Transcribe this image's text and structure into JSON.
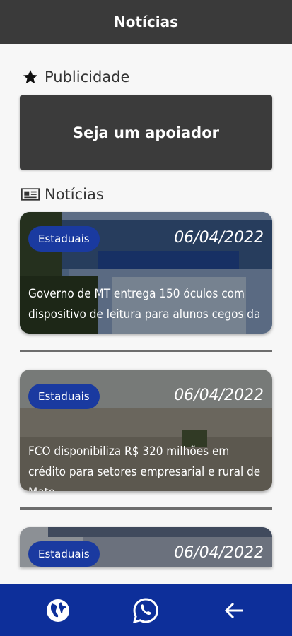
{
  "appbar": {
    "title": "Notícias"
  },
  "ad_section": {
    "title": "Publicidade",
    "banner_text": "Seja um apoiador"
  },
  "news_section": {
    "title": "Notícias"
  },
  "news": [
    {
      "badge": "Estaduais",
      "date": "06/04/2022",
      "headline": "Governo de MT entrega 150 óculos com dispositivo de leitura para alunos cegos da ..."
    },
    {
      "badge": "Estaduais",
      "date": "06/04/2022",
      "headline": "FCO disponibiliza R$ 320 milhões em crédito para setores empresarial e rural de Mato ..."
    },
    {
      "badge": "Estaduais",
      "date": "06/04/2022",
      "headline": ""
    }
  ],
  "nav": {
    "icons": [
      "globe-icon",
      "whatsapp-icon",
      "back-arrow-icon"
    ]
  },
  "colors": {
    "appbar": "#3a3a3a",
    "badge": "#1a3aa0",
    "bottom_nav": "#0d2f9a",
    "ad_box": "#3b3b3b"
  }
}
